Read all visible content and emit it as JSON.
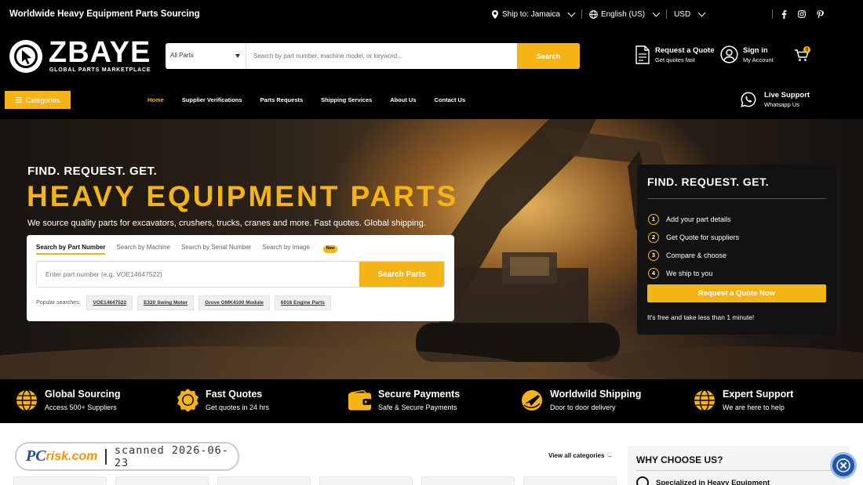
{
  "topbar": {
    "title": "Worldwide Heavy Equipment Parts Sourcing",
    "ship_to": "Ship to: Jamaica",
    "language": "English (US)",
    "currency": "USD",
    "social_icons": [
      "facebook-icon",
      "instagram-icon",
      "pinterest-icon"
    ]
  },
  "brand": {
    "name": "ZBAYE",
    "tagline": "GLOBAL PARTS MARKETPLACE"
  },
  "search": {
    "category": "All Parts",
    "placeholder": "Search by part number, machine model, or keyword...",
    "button": "Search"
  },
  "header_actions": {
    "quote_title": "Request a Quote",
    "quote_sub": "Get quotes fast",
    "signin_title": "Sign in",
    "signin_sub": "My Account",
    "cart_count": "0"
  },
  "nav": {
    "categories": "Categories",
    "items": [
      "Home",
      "Supplier Verifications",
      "Parts Requests",
      "Shipping Services",
      "About Us",
      "Contact Us"
    ],
    "live_title": "Live Support",
    "live_sub": "Whatsapp Us"
  },
  "hero": {
    "kicker": "FIND. REQUEST. GET.",
    "title": "HEAVY EQUIPMENT PARTS",
    "subtitle": "We source quality parts for excavators, crushers, trucks, cranes and more. Fast quotes. Global shipping.",
    "tabs": [
      "Search by Part Number",
      "Search by Machine",
      "Search by Serial Number",
      "Search by Image"
    ],
    "new_badge": "New",
    "part_placeholder": "Enter part number (e.g. VOE14647522)",
    "search_button": "Search Parts",
    "popular_label": "Popular searches:",
    "popular": [
      "VOE14647522",
      "E320 Swing Motor",
      "Grove GMK4100 Module",
      "6016 Engine Parts"
    ]
  },
  "quote_box": {
    "title": "FIND. REQUEST. GET.",
    "steps": [
      "Add your part details",
      "Get Quote for suppliers",
      "Compare & choose",
      "We ship to you"
    ],
    "step_numbers": [
      "1",
      "2",
      "3",
      "4"
    ],
    "button": "Request a Quote Now",
    "note": "It's free and take less than 1 minute!"
  },
  "features": [
    {
      "title": "Global Sourcing",
      "sub": "Access 500+ Suppliers",
      "icon": "globe-icon"
    },
    {
      "title": "Fast Quotes",
      "sub": "Get quotes in 24 hrs",
      "icon": "badge-icon"
    },
    {
      "title": "Secure Payments",
      "sub": "Safe & Secure Payments",
      "icon": "wallet-icon"
    },
    {
      "title": "Worldwild Shipping",
      "sub": "Door to door delivery",
      "icon": "plane-globe-icon"
    },
    {
      "title": "Expert Support",
      "sub": "We are here to help",
      "icon": "support-globe-icon"
    }
  ],
  "watermark": {
    "brand_pc": "PC",
    "brand_risk": "risk.com",
    "scanned": "scanned 2026-06-23"
  },
  "bottom": {
    "view_all": "View all categories",
    "why_title": "WHY CHOOSE US?",
    "why_point": "Specialized in Heavy Equipment"
  },
  "colors": {
    "accent": "#f5b416",
    "header_bg": "#000000",
    "panel": "#121212"
  }
}
